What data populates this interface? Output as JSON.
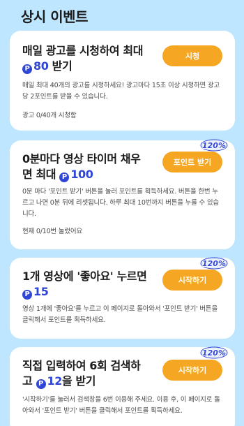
{
  "page": {
    "title": "상시 이벤트"
  },
  "cards": [
    {
      "title_before": "매일 광고를 시청하여 최대",
      "points": "80",
      "title_after": " 받기",
      "button_label": "시청",
      "description": "매일 최대 40개의 광고를 시청하세요! 광고마다 15초 이상 시청하면 광고당 2포인트를 받을 수 있습니다.",
      "status": "광고 0/40개 시청함",
      "badge": ""
    },
    {
      "title_line1": "0분마다 영상 타이머 채우",
      "title_line2_before": "면 최대 ",
      "points": "100",
      "button_label": "포인트 받기",
      "description": "0분 마다 '포인트 받기' 버튼을 눌러 포인트를 획득하세요. 버튼을 한번 누르고 나면 0분 뒤에 리셋됩니다. 하루 최대 10번까지 버튼을 누를 수 있습니다.",
      "status": "현재 0/10번 눌렀어요",
      "badge": "120%"
    },
    {
      "title_line1": "1개 영상에 '좋아요' 누르면",
      "points": "15",
      "button_label": "시작하기",
      "description": "영상 1개에 '좋아요'를 누르고 이 페이지로 돌아와서 '포인트 받기' 버튼을 클릭해서 포인트를 획득하세요.",
      "badge": "120%"
    },
    {
      "title_line1": "직접 입력하여 6회 검색하",
      "title_line2_before": "고 ",
      "points": "12",
      "title_line2_after": "을 받기",
      "button_label": "시작하기",
      "description": "'시작하기'를 눌러서 검색창을 6번 이용해 주세요. 이용 후, 이 페이지로 돌아와서 '포인트 받기' 버튼을 클릭해서 포인트를 획득하세요.",
      "badge": "120%"
    }
  ],
  "icons": {
    "point": "P",
    "point_icon_name": "point-coin-icon",
    "badge_icon_name": "bonus-burst-icon"
  },
  "colors": {
    "background": "#bfe6ff",
    "accent": "#f5a623",
    "brand": "#2f46d6"
  }
}
